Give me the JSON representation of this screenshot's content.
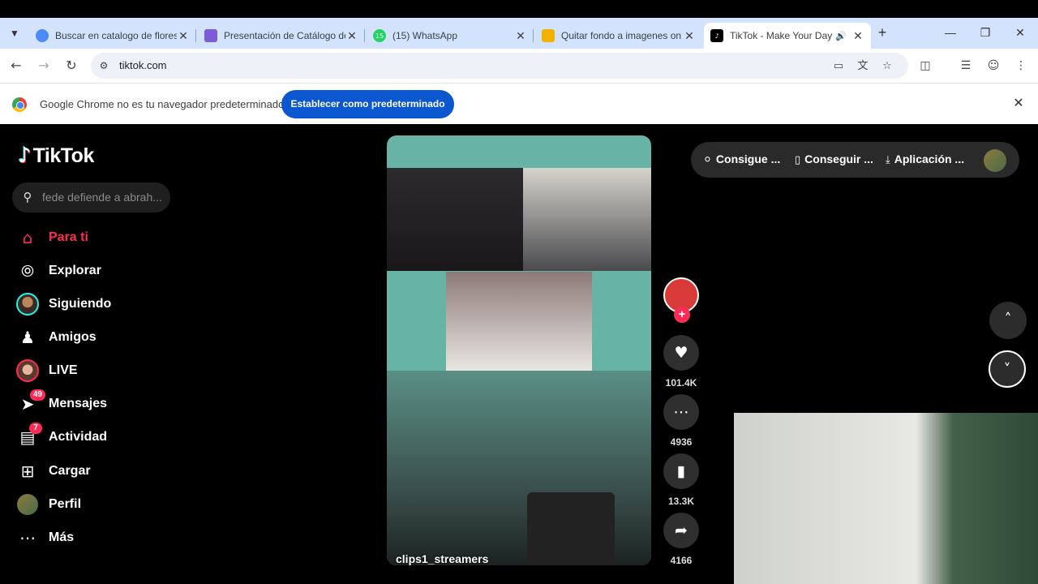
{
  "browser": {
    "tabs": [
      {
        "title": "Buscar en catalogo de flores",
        "favicon_color": "#4c8bf5"
      },
      {
        "title": "Presentación de Catálogo de",
        "favicon_color": "#7b5cd6"
      },
      {
        "title": "(15) WhatsApp",
        "favicon_color": "#25d366",
        "favicon_text": "15"
      },
      {
        "title": "Quitar fondo a imagenes on",
        "favicon_color": "#f2b200"
      },
      {
        "title": "TikTok - Make Your Day",
        "favicon_color": "#000000",
        "active": true
      }
    ],
    "url": "tiktok.com",
    "infobar": {
      "message": "Google Chrome no es tu navegador predeterminado",
      "button": "Establecer como predeterminado"
    }
  },
  "tiktok": {
    "logo_text": "TikTok",
    "search_placeholder": "fede defiende a abrah...",
    "nav": [
      {
        "label": "Para ti",
        "icon": "home-icon",
        "active": true
      },
      {
        "label": "Explorar",
        "icon": "compass-icon"
      },
      {
        "label": "Siguiendo",
        "icon": "following-avatar"
      },
      {
        "label": "Amigos",
        "icon": "friends-icon"
      },
      {
        "label": "LIVE",
        "icon": "live-avatar"
      },
      {
        "label": "Mensajes",
        "icon": "messages-icon",
        "badge": "49"
      },
      {
        "label": "Actividad",
        "icon": "activity-icon",
        "badge": "7"
      },
      {
        "label": "Cargar",
        "icon": "upload-icon"
      },
      {
        "label": "Perfil",
        "icon": "profile-avatar"
      },
      {
        "label": "Más",
        "icon": "more-icon"
      }
    ],
    "video": {
      "caption": "clips1_streamers"
    },
    "actions": {
      "likes": "101.4K",
      "comments": "4936",
      "saves": "13.3K",
      "shares": "4166"
    },
    "topbar": {
      "coins": "Consigue ...",
      "app_pc": "Conseguir ...",
      "app": "Aplicación ..."
    },
    "accent": "#fe2c55"
  }
}
